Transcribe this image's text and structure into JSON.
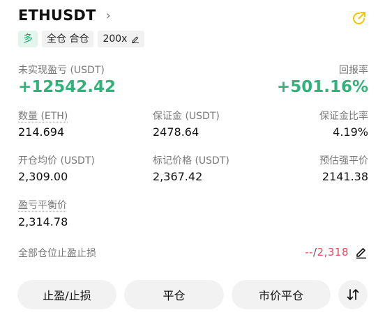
{
  "header": {
    "symbol": "ETHUSDT",
    "chevron": "›",
    "share_icon": "share-icon",
    "accent_color": "#f5c400"
  },
  "tags": {
    "side": "多",
    "margin_mode": "全仓 合仓",
    "leverage": "200x"
  },
  "pnl": {
    "label": "未实现盈亏 (USDT)",
    "value": "+12542.42",
    "roe_label": "回报率",
    "roe_value": "+501.16%",
    "positive_color": "#2fb37a"
  },
  "stats": {
    "qty_label": "数量 (ETH)",
    "qty_value": "214.694",
    "margin_label": "保证金 (USDT)",
    "margin_value": "2478.64",
    "margin_ratio_label": "保证金比率",
    "margin_ratio_value": "4.19%",
    "entry_label": "开仓均价 (USDT)",
    "entry_value": "2,309.00",
    "mark_label": "标记价格 (USDT)",
    "mark_value": "2,367.42",
    "liq_label": "预估强平价",
    "liq_value": "2141.38",
    "breakeven_label": "盈亏平衡价",
    "breakeven_value": "2,314.78"
  },
  "tpsl": {
    "label": "全部仓位止盈止损",
    "sl_value": "--",
    "separator": "/",
    "tp_value": "2,318",
    "edit_icon": "edit-icon",
    "negative_color": "#e0475a"
  },
  "actions": {
    "tpsl_button": "止盈/止损",
    "close_button": "平仓",
    "market_close_button": "市价平仓",
    "reverse_icon": "swap-arrows-icon"
  }
}
